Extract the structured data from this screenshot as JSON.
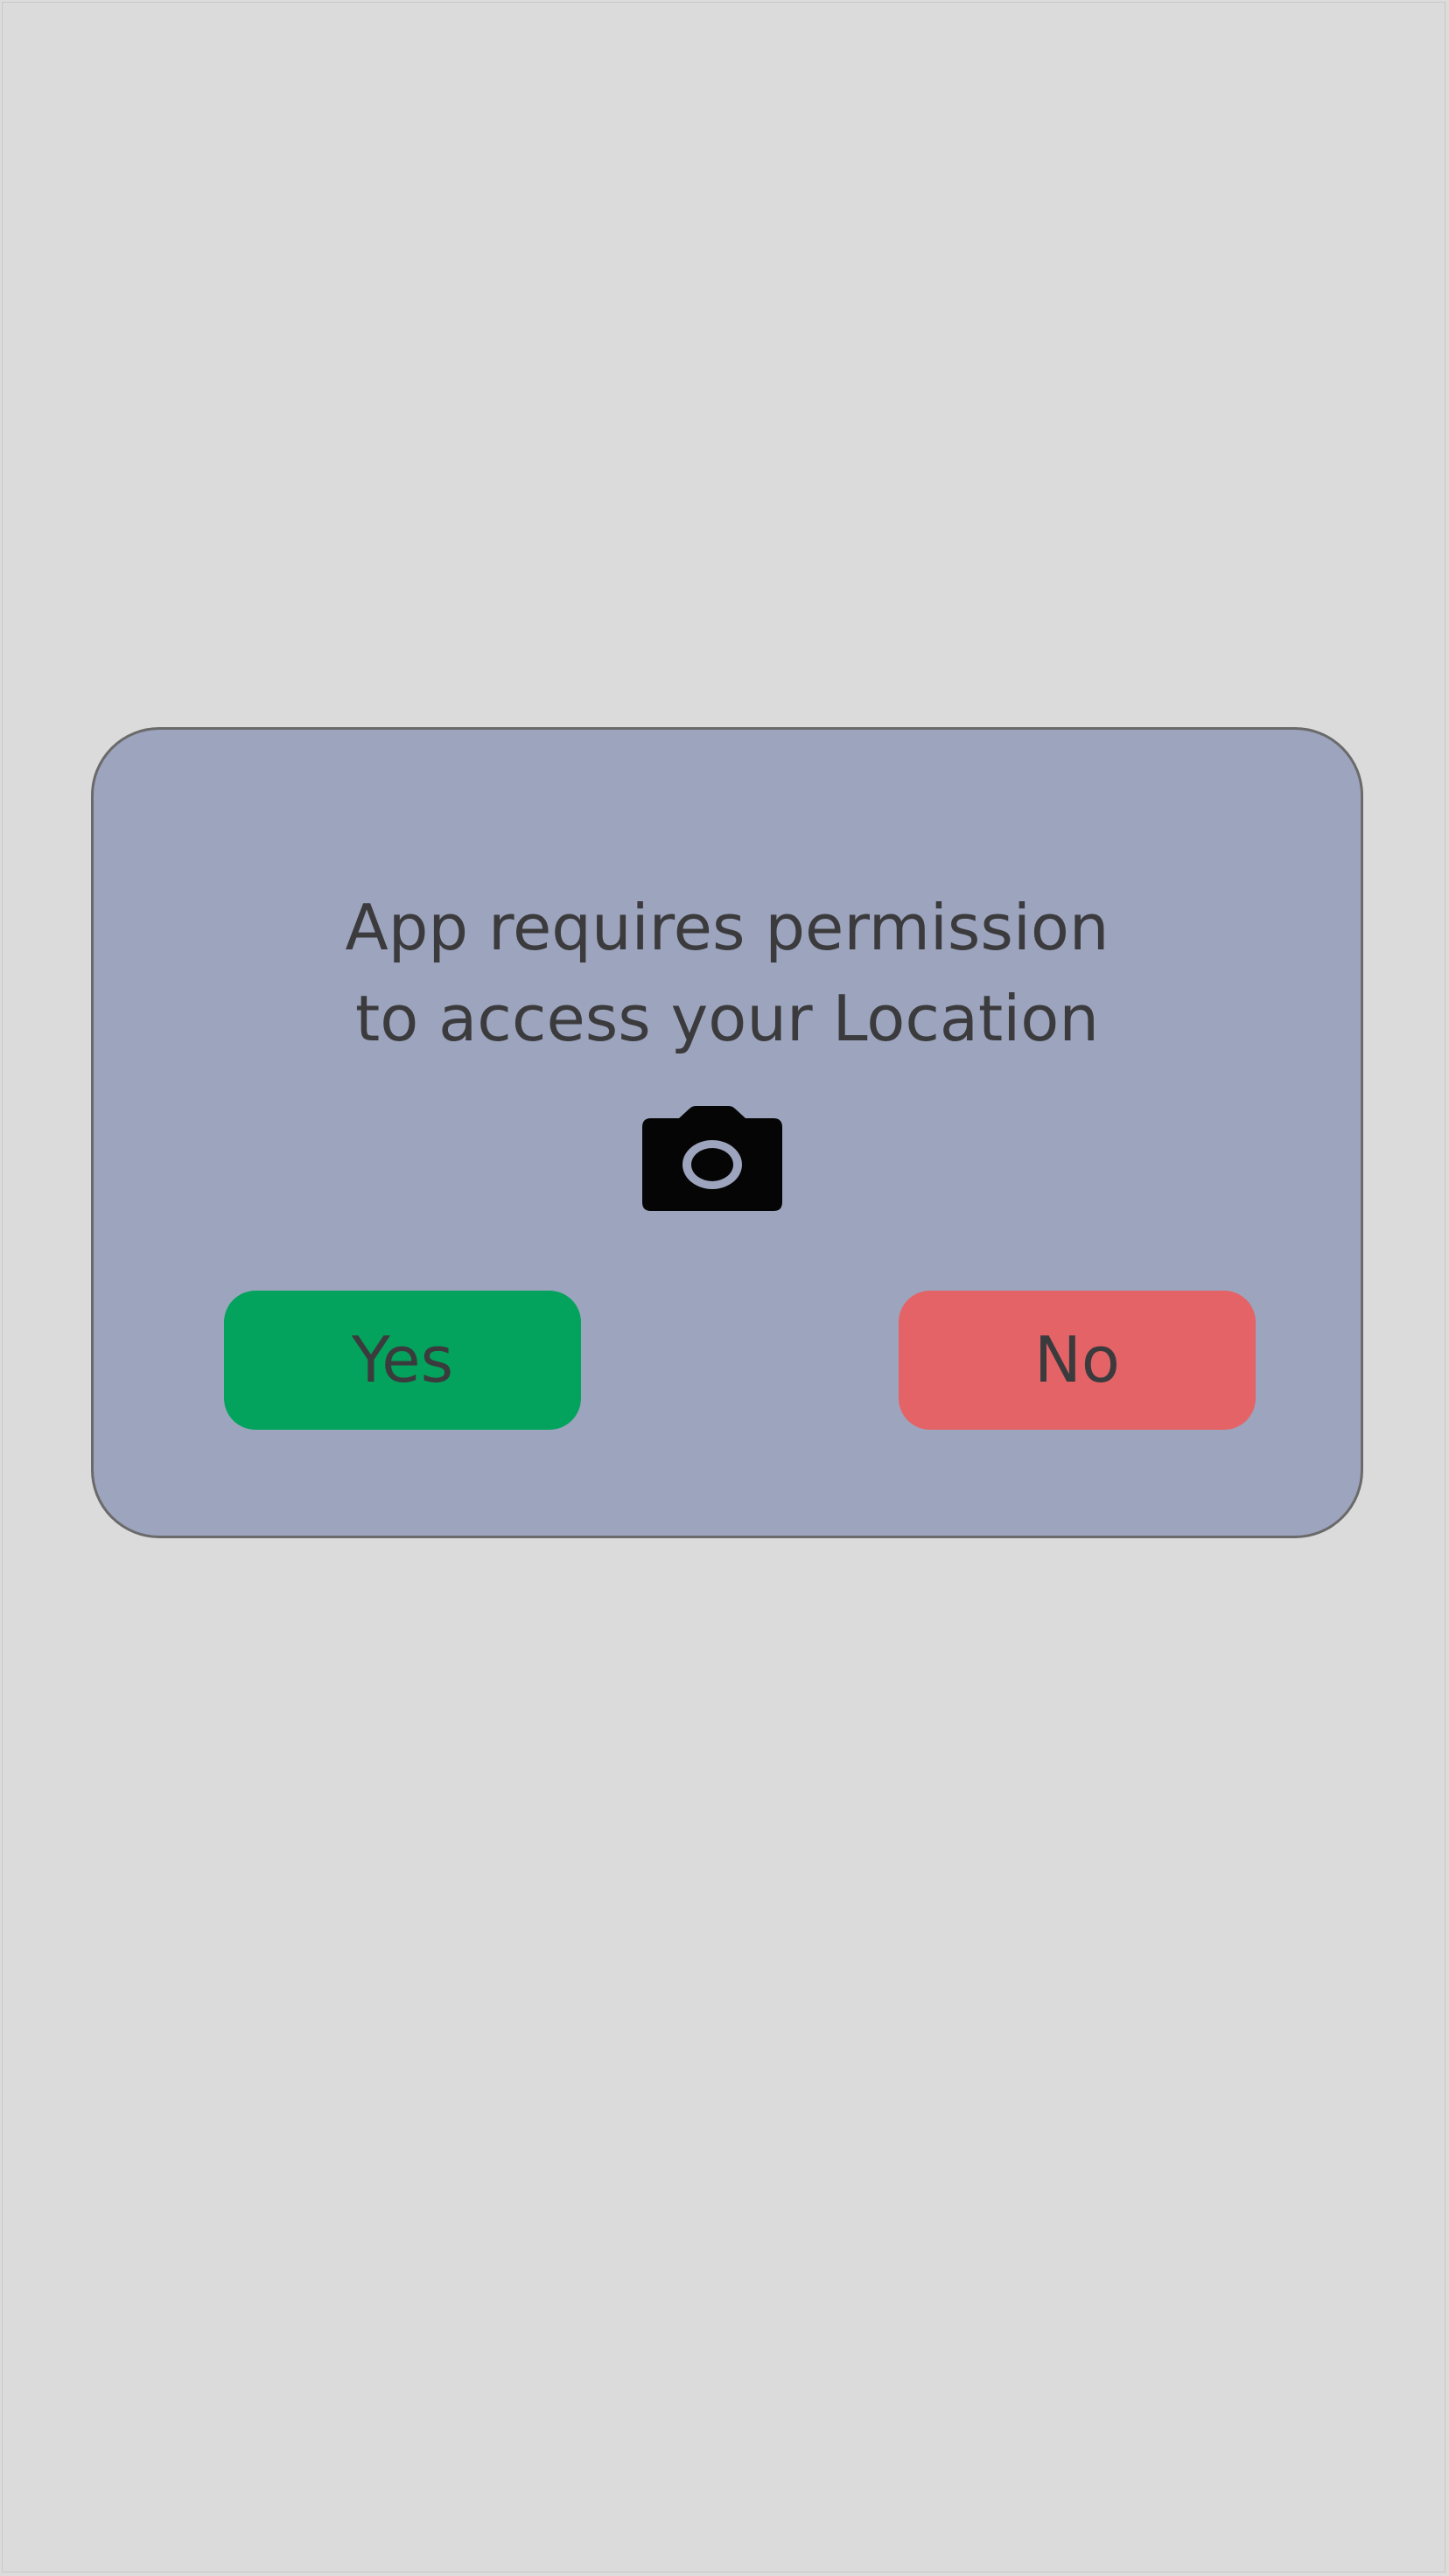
{
  "dialog": {
    "message_line1": "App requires permission",
    "message_line2": "to access your Location",
    "icon": "camera-icon",
    "yes_label": "Yes",
    "no_label": "No"
  },
  "colors": {
    "background": "#dbdbdc",
    "dialog_background": "#9da4bd",
    "dialog_border": "#6a6a6a",
    "text": "#3b3b3d",
    "yes_button": "#03a35d",
    "no_button": "#e36367",
    "icon": "#050505"
  }
}
